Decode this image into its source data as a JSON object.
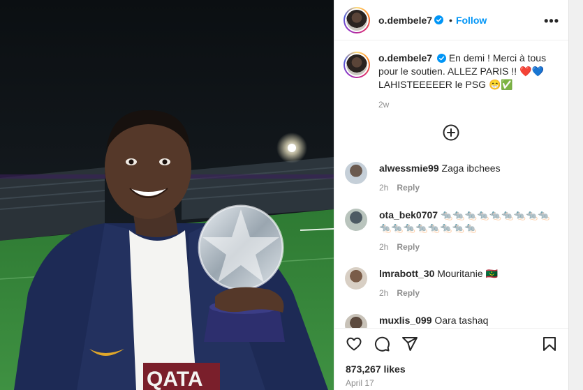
{
  "post": {
    "username": "o.dembele7",
    "separator": "•",
    "follow_label": "Follow",
    "more_label": "•••"
  },
  "caption": {
    "username": "o.dembele7",
    "text_line1": "En demi ! Merci à tous",
    "text_line2": "pour le soutien. ALLEZ PARIS !! ❤️💙",
    "text_line3": "LAHISTEEEEER le PSG 😁✅",
    "time": "2w"
  },
  "comments": [
    {
      "username": "alwessmie99",
      "text": "Zaga ibchees",
      "time": "2h",
      "reply": "Reply"
    },
    {
      "username": "ota_bek0707",
      "text": "🐀🐀🐀🐀🐀🐀🐀🐀🐀",
      "text2": "🐀🐀🐀🐀🐀🐀🐀🐀",
      "time": "2h",
      "reply": "Reply"
    },
    {
      "username": "lmrabott_30",
      "text": "Mouritanie 🇲🇷",
      "time": "2h",
      "reply": "Reply"
    },
    {
      "username": "muxlis_099",
      "text": "Oara tashaq"
    }
  ],
  "footer": {
    "likes": "873,267 likes",
    "date": "April 17"
  },
  "photo": {
    "shirt_text": "QATA"
  },
  "icons": [
    "verified-badge-icon",
    "more-options-icon",
    "load-more-comments-icon",
    "heart-icon",
    "comment-icon",
    "share-icon",
    "bookmark-icon"
  ],
  "colors": {
    "accent": "#0095f6",
    "verified": "#0095f6",
    "muted": "#8e8e8e",
    "text": "#262626"
  }
}
